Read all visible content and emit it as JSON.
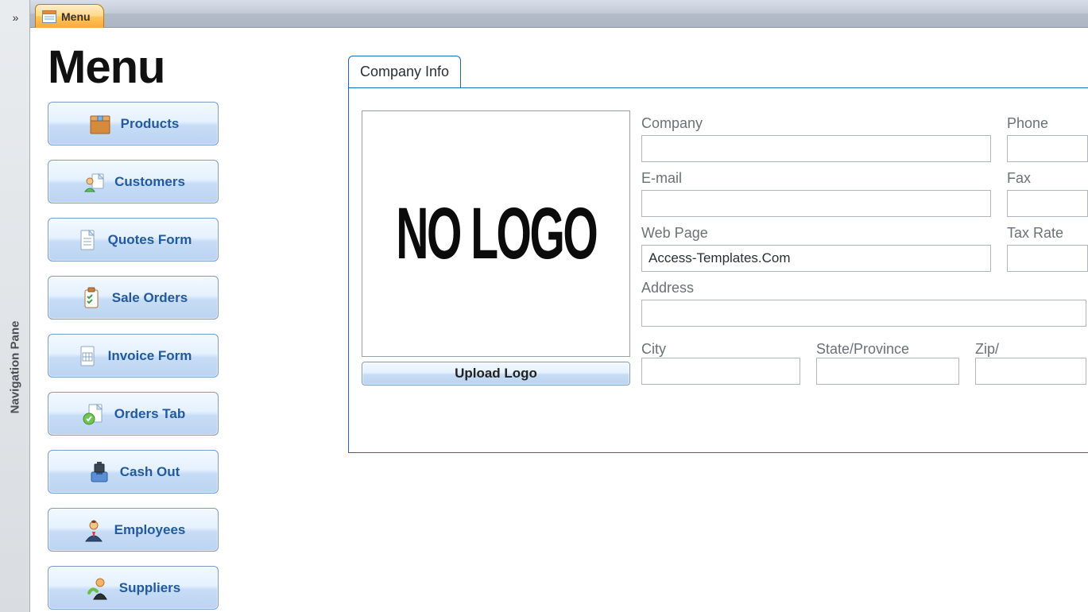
{
  "nav": {
    "label": "Navigation Pane"
  },
  "docTab": {
    "label": "Menu"
  },
  "menu": {
    "title": "Menu",
    "items": [
      {
        "label": "Products",
        "icon": "box-icon"
      },
      {
        "label": "Customers",
        "icon": "customer-icon"
      },
      {
        "label": "Quotes Form",
        "icon": "document-icon"
      },
      {
        "label": "Sale Orders",
        "icon": "clipboard-icon"
      },
      {
        "label": "Invoice Form",
        "icon": "invoice-icon"
      },
      {
        "label": "Orders Tab",
        "icon": "orders-icon"
      },
      {
        "label": "Cash Out",
        "icon": "cashout-icon"
      },
      {
        "label": "Employees",
        "icon": "employee-icon"
      },
      {
        "label": "Suppliers",
        "icon": "supplier-icon"
      }
    ]
  },
  "companyPanel": {
    "tabLabel": "Company Info",
    "logoPlaceholder": "NO LOGO",
    "uploadLabel": "Upload Logo",
    "labels": {
      "company": "Company",
      "email": "E-mail",
      "webpage": "Web Page",
      "address": "Address",
      "city": "City",
      "state": "State/Province",
      "zip": "Zip/",
      "phone": "Phone",
      "fax": "Fax",
      "taxrate": "Tax Rate"
    },
    "values": {
      "company": "",
      "email": "",
      "webpage": "Access-Templates.Com",
      "address": "",
      "city": "",
      "state": "",
      "zip": "",
      "phone": "",
      "fax": "",
      "taxrate": ""
    }
  }
}
